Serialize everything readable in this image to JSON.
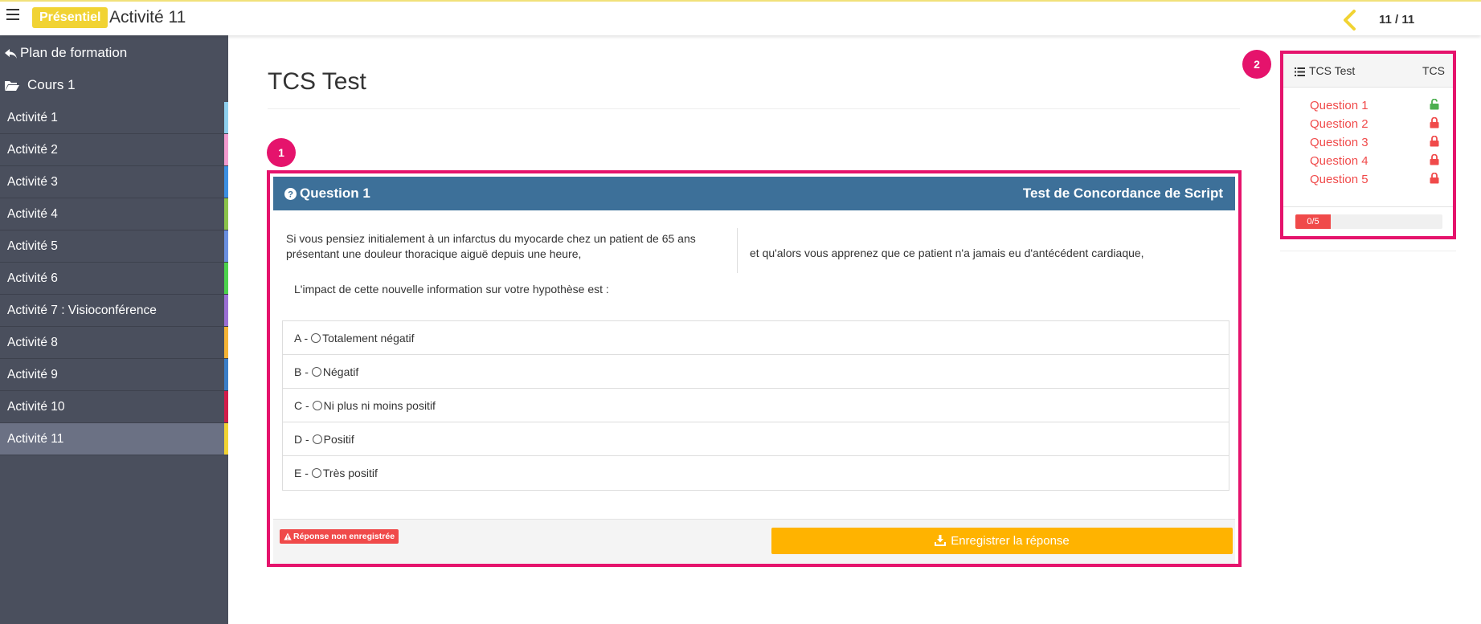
{
  "topbar": {
    "mode_badge": "Présentiel",
    "title": "Activité 11",
    "page_counter": "11 / 11"
  },
  "sidebar": {
    "back_label": "Plan de formation",
    "course_label": "Cours 1",
    "items": [
      {
        "label": "Activité 1",
        "color": "#8fd0ee"
      },
      {
        "label": "Activité 2",
        "color": "#f39bcf"
      },
      {
        "label": "Activité 3",
        "color": "#3b8fe2"
      },
      {
        "label": "Activité 4",
        "color": "#8bc34a"
      },
      {
        "label": "Activité 5",
        "color": "#6a8fe0"
      },
      {
        "label": "Activité 6",
        "color": "#4cd24c"
      },
      {
        "label": "Activité 7 : Visioconférence",
        "color": "#9b6fd4"
      },
      {
        "label": "Activité 8",
        "color": "#f5b335"
      },
      {
        "label": "Activité 9",
        "color": "#3a7ec8"
      },
      {
        "label": "Activité 10",
        "color": "#d21d4a"
      },
      {
        "label": "Activité 11",
        "color": "#f1d333"
      }
    ]
  },
  "main": {
    "title": "TCS Test"
  },
  "markers": {
    "question": "1",
    "panel": "2"
  },
  "question": {
    "label": "Question 1",
    "type": "Test de Concordance de Script",
    "stem_left": "Si vous pensiez initialement à un infarctus du myocarde chez un patient de 65 ans présentant une douleur thoracique aiguë depuis une heure,",
    "stem_right": "et qu'alors vous apprenez que ce patient n'a jamais eu d'antécédent cardiaque,",
    "impact_prompt": "L'impact de cette nouvelle information sur votre hypothèse est :",
    "options": [
      {
        "letter": "A -",
        "label": "Totalement négatif"
      },
      {
        "letter": "B -",
        "label": "Négatif"
      },
      {
        "letter": "C -",
        "label": "Ni plus ni moins positif"
      },
      {
        "letter": "D -",
        "label": "Positif"
      },
      {
        "letter": "E -",
        "label": "Très positif"
      }
    ],
    "warning": "Réponse non enregistrée",
    "save_label": "Enregistrer la réponse"
  },
  "panel": {
    "title": "TCS Test",
    "type": "TCS",
    "questions": [
      {
        "label": "Question 1",
        "lock": "unlocked",
        "lock_color": "#4caf50"
      },
      {
        "label": "Question 2",
        "lock": "locked",
        "lock_color": "#f04a4a"
      },
      {
        "label": "Question 3",
        "lock": "locked",
        "lock_color": "#f04a4a"
      },
      {
        "label": "Question 4",
        "lock": "locked",
        "lock_color": "#f04a4a"
      },
      {
        "label": "Question 5",
        "lock": "locked",
        "lock_color": "#f04a4a"
      }
    ],
    "progress_label": "0/5",
    "progress_done": 0,
    "progress_total": 5
  },
  "colors": {
    "accent": "#e5136c",
    "header_blue": "#3d7099",
    "save": "#ffb300",
    "badge": "#f1d333",
    "warning": "#f04a4a"
  }
}
